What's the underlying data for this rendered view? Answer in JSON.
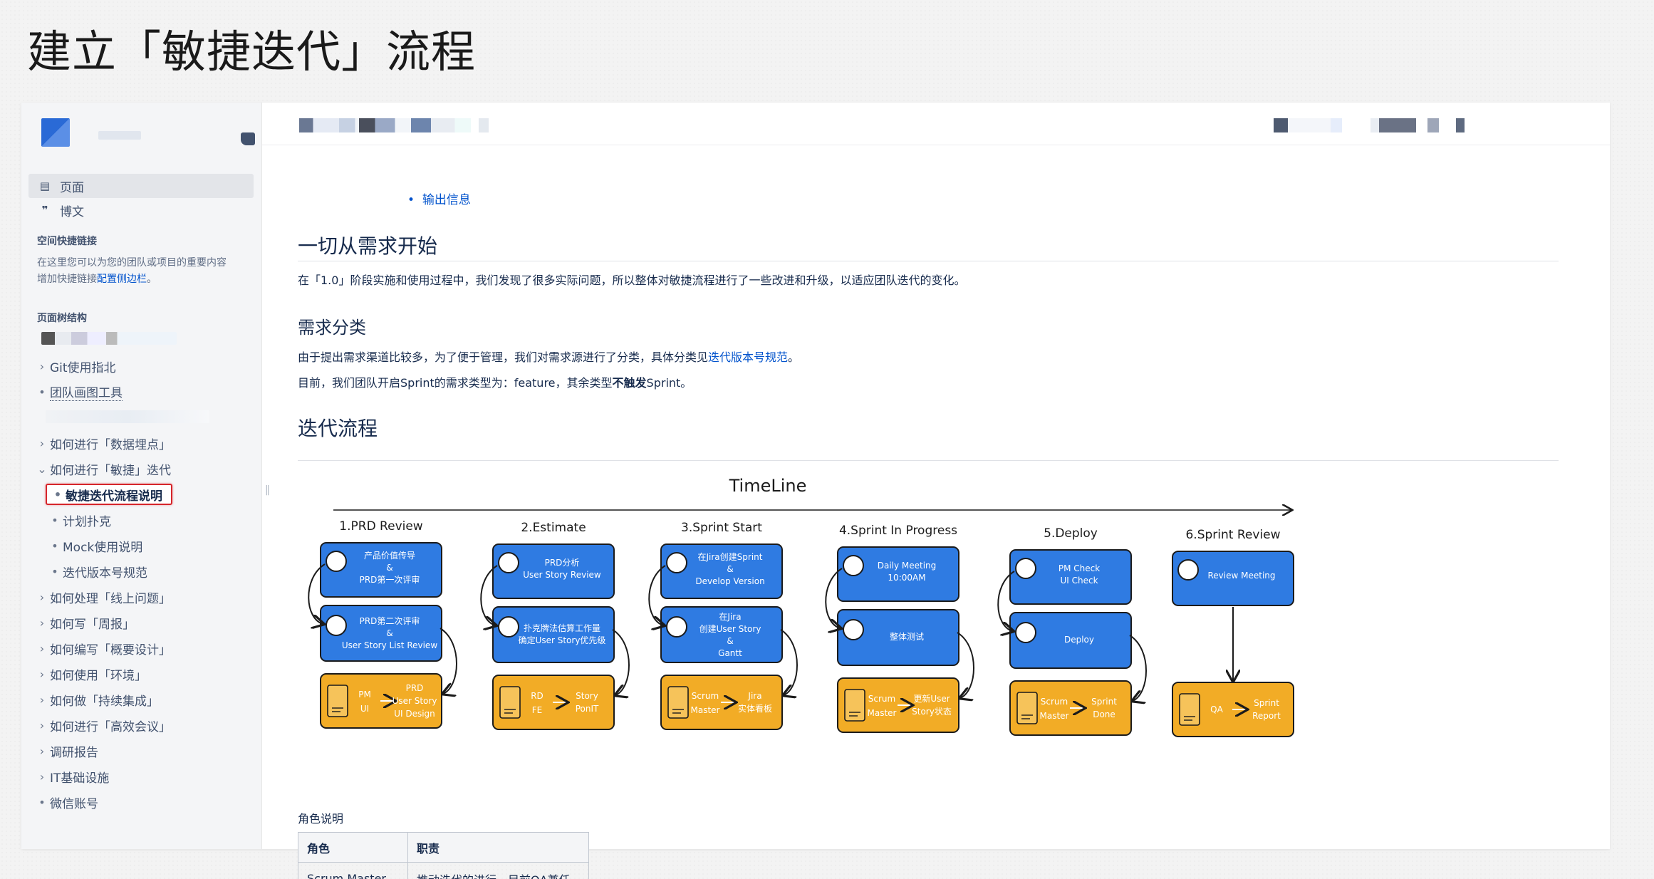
{
  "slide_title": "建立「敏捷迭代」流程",
  "sidebar": {
    "nav": [
      {
        "label": "页面",
        "icon": "page-icon"
      },
      {
        "label": "博文",
        "icon": "quote-icon"
      }
    ],
    "shortcuts_heading": "空间快捷链接",
    "shortcuts_text_1": "在这里您可以为您的团队或项目的重要内容",
    "shortcuts_text_2": "增加快捷链接",
    "shortcuts_link": "配置侧边栏",
    "shortcuts_text_3": "。",
    "tree_heading": "页面树结构",
    "tree": [
      {
        "label": "Git使用指北",
        "bullet": "›"
      },
      {
        "label": "团队画图工具",
        "bullet": "•"
      },
      {
        "label": "如何进行「数据埋点」",
        "bullet": "›"
      },
      {
        "label": "如何进行「敏捷」迭代",
        "bullet": "⌄"
      },
      {
        "label": "敏捷迭代流程说明",
        "bullet": "•"
      },
      {
        "label": "计划扑克",
        "bullet": "•"
      },
      {
        "label": "Mock使用说明",
        "bullet": "•"
      },
      {
        "label": "迭代版本号规范",
        "bullet": "•"
      },
      {
        "label": "如何处理「线上问题」",
        "bullet": "›"
      },
      {
        "label": "如何写「周报」",
        "bullet": "›"
      },
      {
        "label": "如何编写「概要设计」",
        "bullet": "›"
      },
      {
        "label": "如何使用「环境」",
        "bullet": "›"
      },
      {
        "label": "如何做「持续集成」",
        "bullet": "›"
      },
      {
        "label": "如何进行「高效会议」",
        "bullet": "›"
      },
      {
        "label": "调研报告",
        "bullet": "›"
      },
      {
        "label": "IT基础设施",
        "bullet": "›"
      },
      {
        "label": "微信账号",
        "bullet": "•"
      }
    ]
  },
  "content": {
    "top_link": "输出信息",
    "section1_title": "一切从需求开始",
    "section1_para": "在「1.0」阶段实施和使用过程中，我们发现了很多实际问题，所以整体对敏捷流程进行了一些改进和升级，以适应团队迭代的变化。",
    "section2_title": "需求分类",
    "section2_para_a": "由于提出需求渠道比较多，为了便于管理，我们对需求源进行了分类，具体分类见",
    "section2_link": "迭代版本号规范",
    "section2_para_b": "。",
    "section2_para2_a": "目前，我们团队开启Sprint的需求类型为：feature，其余类型",
    "section2_para2_bold": "不触发",
    "section2_para2_b": "Sprint。",
    "section3_title": "迭代流程",
    "roles_caption": "角色说明",
    "roles_table": {
      "headers": [
        "角色",
        "职责"
      ],
      "rows": [
        [
          "Scrum Master",
          "推动迭代的进行，目前QA兼任"
        ]
      ]
    }
  },
  "diagram": {
    "timeline_label": "TimeLine",
    "colors": {
      "blue": "#2f7be2",
      "orange": "#f2ac26",
      "border": "#1b1b1b"
    },
    "stages": [
      {
        "title": "1.PRD Review",
        "step1": [
          "产品价值传导",
          "&",
          "PRD第一次评审"
        ],
        "step2": [
          "PRD第二次评审",
          "&",
          "User Story List Review"
        ],
        "out_left": [
          "PM",
          "UI"
        ],
        "out_right": [
          "PRD",
          "User Story",
          "UI Design"
        ]
      },
      {
        "title": "2.Estimate",
        "step1": [
          "PRD分析",
          "User Story Review"
        ],
        "step2": [
          "扑克牌法估算工作量",
          "确定User Story优先级"
        ],
        "out_left": [
          "RD",
          "FE"
        ],
        "out_right": [
          "Story",
          "PonIT"
        ]
      },
      {
        "title": "3.Sprint Start",
        "step1": [
          "在Jira创建Sprint",
          "&",
          "Develop Version"
        ],
        "step2": [
          "在Jira",
          "创建User Story",
          "&",
          "Gantt"
        ],
        "out_left": [
          "Scrum",
          "Master"
        ],
        "out_right": [
          "Jira",
          "实体看板"
        ]
      },
      {
        "title": "4.Sprint In Progress",
        "step1": [
          "Daily Meeting",
          "10:00AM"
        ],
        "step2": [
          "整体测试"
        ],
        "out_left": [
          "Scrum",
          "Master"
        ],
        "out_right": [
          "更新User",
          "Story状态"
        ]
      },
      {
        "title": "5.Deploy",
        "step1": [
          "PM Check",
          "UI Check"
        ],
        "step2": [
          "Deploy"
        ],
        "out_left": [
          "Scrum",
          "Master"
        ],
        "out_right": [
          "Sprint",
          "Done"
        ]
      },
      {
        "title": "6.Sprint Review",
        "step1": [
          "Review Meeting"
        ],
        "step2": [],
        "out_left": [
          "QA"
        ],
        "out_right": [
          "Sprint",
          "Report"
        ]
      }
    ]
  }
}
